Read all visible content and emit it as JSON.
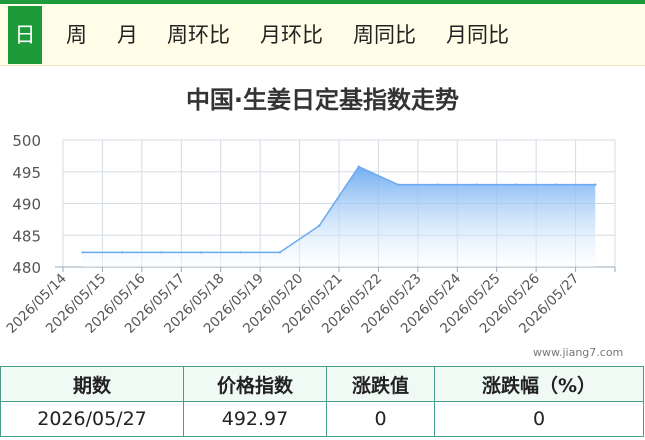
{
  "tabs": [
    {
      "label": "日",
      "active": true
    },
    {
      "label": "周",
      "active": false
    },
    {
      "label": "月",
      "active": false
    },
    {
      "label": "周环比",
      "active": false
    },
    {
      "label": "月环比",
      "active": false
    },
    {
      "label": "周同比",
      "active": false
    },
    {
      "label": "月同比",
      "active": false
    }
  ],
  "colors": {
    "accent": "#1c9b38",
    "line": "#6aaaf0",
    "table_border": "#4a9c8c",
    "tab_bar": "#fffde8"
  },
  "watermark": "www.jiang7.com",
  "chart_data": {
    "type": "area",
    "title": "中国·生姜日定基指数走势",
    "x": [
      "2026/05/14",
      "2026/05/15",
      "2026/05/16",
      "2026/05/17",
      "2026/05/18",
      "2026/05/19",
      "2026/05/20",
      "2026/05/21",
      "2026/05/22",
      "2026/05/23",
      "2026/05/24",
      "2026/05/25",
      "2026/05/26",
      "2026/05/27"
    ],
    "series": [
      {
        "values": [
          482.3,
          482.3,
          482.3,
          482.3,
          482.3,
          482.3,
          486.5,
          495.8,
          492.97,
          492.97,
          492.97,
          492.97,
          492.97,
          492.97
        ]
      }
    ],
    "ylim": [
      480,
      500
    ],
    "yticks": [
      480,
      485,
      490,
      495,
      500
    ],
    "grid": true,
    "xlabel": "",
    "ylabel": ""
  },
  "table": {
    "headers": [
      "期数",
      "价格指数",
      "涨跌值",
      "涨跌幅（%）"
    ],
    "rows": [
      [
        "2026/05/27",
        "492.97",
        "0",
        "0"
      ]
    ]
  }
}
